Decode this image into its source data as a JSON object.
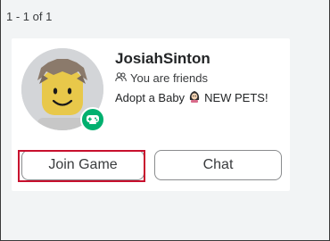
{
  "pagination": {
    "label": "1 - 1 of 1"
  },
  "friend_card": {
    "username": "JosiahSinton",
    "status": "You are friends",
    "game_prefix": "Adopt a Baby",
    "game_suffix": "NEW PETS!",
    "presence": "in-game",
    "buttons": {
      "join": "Join Game",
      "chat": "Chat"
    }
  },
  "icons": {
    "friends": "friends-icon",
    "game": "game-character-icon",
    "presence": "gamepad-icon"
  },
  "colors": {
    "presence_green": "#00b06f",
    "highlight_red": "#c8102e",
    "card_bg": "#ffffff",
    "page_bg": "#f2f4f5"
  }
}
